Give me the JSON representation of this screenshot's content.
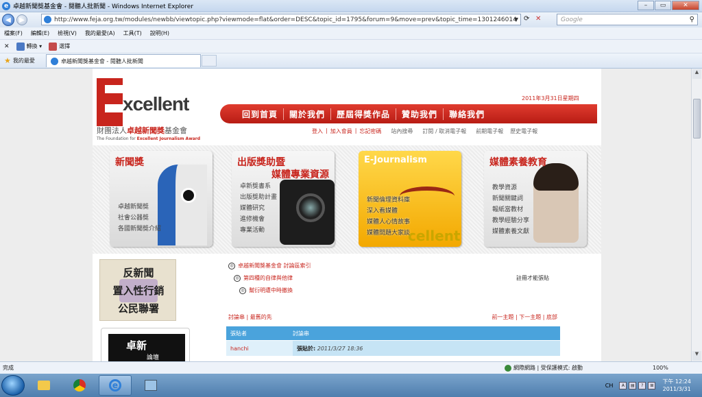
{
  "window": {
    "title": "卓越新聞獎基金會 - 閱聽人批新聞 - Windows Internet Explorer"
  },
  "address": {
    "url": "http://www.feja.org.tw/modules/newbb/viewtopic.php?viewmode=flat&order=DESC&topic_id=1795&forum=9&move=prev&topic_time=1301246014"
  },
  "search": {
    "placeholder": "Google"
  },
  "menu": [
    "檔案(F)",
    "編輯(E)",
    "檢視(V)",
    "我的最愛(A)",
    "工具(T)",
    "說明(H)"
  ],
  "links_bar": {
    "convert": "轉換",
    "select": "選擇"
  },
  "favorites": {
    "label": "我的最愛",
    "tab_title": "卓越新聞獎基金會 - 閱聽人批新聞"
  },
  "site": {
    "logo_word": "xcellent",
    "logo_zh_prefix": "財團法人",
    "logo_zh_bold": "卓越新聞獎",
    "logo_zh_suffix": "基金會",
    "logo_en_prefix": "The Foundation for ",
    "logo_en_bold": "Excellent Journalism Award",
    "date": "2011年3月31日星期四",
    "nav": [
      "回到首頁",
      "關於我們",
      "歷屆得獎作品",
      "贊助我們",
      "聯絡我們"
    ],
    "subnav": {
      "login": "登入",
      "join": "加入會員",
      "forgot": "忘記密碼",
      "search": "站內搜尋",
      "subscribe": "訂閱 / 取消電子報",
      "latest": "前期電子報",
      "history": "歷史電子報"
    }
  },
  "banners": [
    {
      "title": "新聞獎",
      "items": [
        "卓越新聞獎",
        "社會公器獎",
        "各國新聞獎介紹"
      ]
    },
    {
      "title": "出版獎助暨",
      "title2": "媒體專業資源",
      "items": [
        "卓新獎書系",
        "出版獎助計畫",
        "媒體研究",
        "進修機會",
        "專業活動"
      ]
    },
    {
      "title": "E-Journalism",
      "big": "cellent",
      "items": [
        "新聞倫理資料庫",
        "深入看媒體",
        "媒體人心情故事",
        "媒體問題大家談"
      ]
    },
    {
      "title": "媒體素養教育",
      "items": [
        "教學資源",
        "新聞關鍵詞",
        "報紙當教材",
        "教學經驗分享",
        "媒體素養文獻"
      ]
    }
  ],
  "sidebar": {
    "anti_lines": [
      "反新聞",
      "置入性行銷",
      "公民聯署"
    ],
    "forum_title": "卓新",
    "forum_sub": "論壇"
  },
  "breadcrumbs": [
    "卓越新聞獎基金會 討論區索引",
    "第四種的自律與他律",
    "幫衍明遭中時撤換"
  ],
  "register_note": "註冊才能張貼",
  "thread_nav": {
    "left": "討論串 | 最舊的先",
    "right": "前一主題 | 下一主題 | 底部"
  },
  "table": {
    "col1": "張貼者",
    "col2": "討論串",
    "poster": "hanchi",
    "posted_label": "張貼於:",
    "posted_time": "2011/3/27 18:36"
  },
  "status": {
    "done": "完成",
    "zone": "網際網路 | 受保護模式: 啟動",
    "zoom": "100%"
  },
  "tray": {
    "lang": "CH",
    "time": "下午 12:24",
    "date": "2011/3/31"
  }
}
